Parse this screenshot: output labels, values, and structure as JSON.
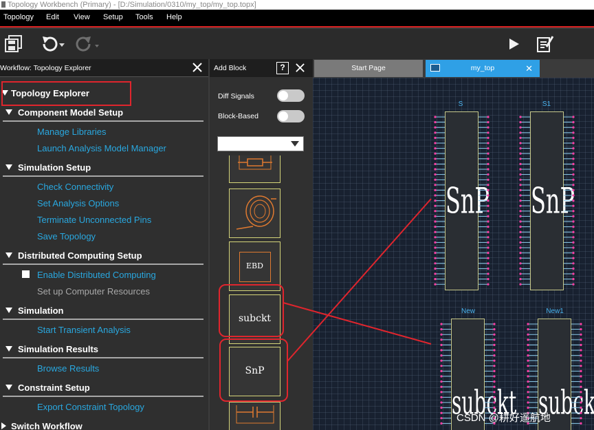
{
  "window": {
    "title": "Topology Workbench (Primary) - [D:/Simulation/0310/my_top/my_top.topx]"
  },
  "menu": [
    "Topology",
    "Edit",
    "View",
    "Setup",
    "Tools",
    "Help"
  ],
  "toolbar": {
    "icons": [
      "save-all-icon",
      "undo-icon",
      "redo-icon",
      "run-icon",
      "report-icon"
    ]
  },
  "workflow": {
    "header": "Workflow: Topology Explorer",
    "root": "Topology Explorer",
    "sections": [
      {
        "title": "Component Model Setup",
        "items": [
          {
            "label": "Manage Libraries"
          },
          {
            "label": "Launch Analysis Model Manager"
          }
        ]
      },
      {
        "title": "Simulation Setup",
        "items": [
          {
            "label": "Check Connectivity"
          },
          {
            "label": "Set Analysis Options"
          },
          {
            "label": "Terminate Unconnected Pins"
          },
          {
            "label": "Save Topology"
          }
        ]
      },
      {
        "title": "Distributed Computing Setup",
        "items": [
          {
            "label": "Enable Distributed Computing",
            "checkbox": true
          },
          {
            "label": "Set up Computer Resources",
            "disabled": true
          }
        ]
      },
      {
        "title": "Simulation",
        "items": [
          {
            "label": "Start Transient Analysis"
          }
        ]
      },
      {
        "title": "Simulation Results",
        "items": [
          {
            "label": "Browse Results"
          }
        ]
      },
      {
        "title": "Constraint Setup",
        "items": [
          {
            "label": "Export Constraint Topology"
          }
        ]
      }
    ],
    "footer": "Switch Workflow"
  },
  "add_block": {
    "header": "Add Block",
    "toggles": [
      {
        "label": "Diff Signals",
        "on": false
      },
      {
        "label": "Block-Based",
        "on": false
      }
    ],
    "blocks": [
      {
        "name": "resistor"
      },
      {
        "name": "coil"
      },
      {
        "name": "EBD",
        "label": "EBD"
      },
      {
        "name": "subckt",
        "label": "subckt"
      },
      {
        "name": "SnP",
        "label": "SnP"
      },
      {
        "name": "capacitor"
      }
    ]
  },
  "tabs": [
    {
      "label": "Start Page",
      "active": false
    },
    {
      "label": "my_top",
      "active": true
    }
  ],
  "canvas": {
    "components": [
      {
        "id": "S",
        "label": "S",
        "type": "SnP"
      },
      {
        "id": "S1",
        "label": "S1",
        "type": "SnP"
      },
      {
        "id": "New",
        "label": "New",
        "type": "subckt"
      },
      {
        "id": "New1",
        "label": "New1",
        "type": "subckt"
      }
    ]
  },
  "watermark": "CSDN @耕好遥航地",
  "colors": {
    "accent": "#2fa0e6",
    "link": "#29a8e0",
    "annotation": "#e0252d",
    "menubar": "#000000"
  }
}
